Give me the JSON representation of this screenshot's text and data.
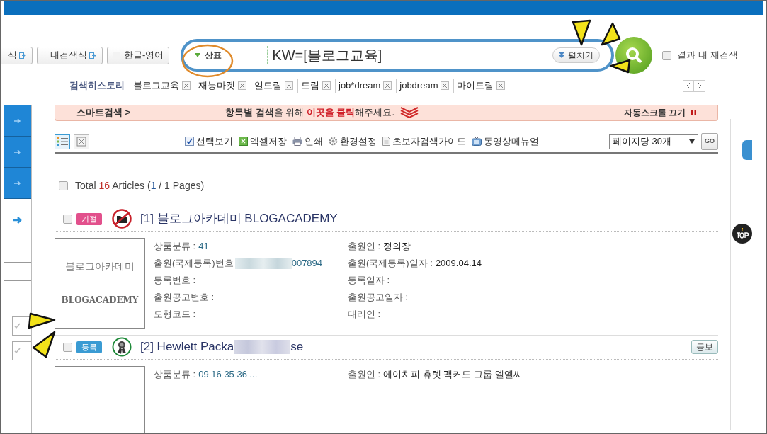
{
  "sidebar": {
    "checkboxes": [
      {
        "checked": true
      },
      {
        "checked": true
      }
    ]
  },
  "search_bar": {
    "formula_buttons": [
      {
        "label": "식"
      },
      {
        "label": "내검색식"
      }
    ],
    "language_toggle": {
      "label": "한글-영어",
      "checked": false
    },
    "category": "상표",
    "query": "KW=[블로그교육]",
    "expand_button": "펼치기",
    "refine": {
      "label": "결과 내 재검색",
      "checked": false
    }
  },
  "history": {
    "label": "검색히스토리",
    "items": [
      {
        "label": "블로그교육"
      },
      {
        "label": "재능마켓"
      },
      {
        "label": "일드림"
      },
      {
        "label": "드림"
      },
      {
        "label": "job*dream"
      },
      {
        "label": "jobdream"
      },
      {
        "label": "마이드림"
      }
    ]
  },
  "smart_banner": {
    "title": "스마트검색 >",
    "message": [
      {
        "text": "항목별 검색",
        "kind": "bold"
      },
      {
        "text": "을 위해 ",
        "kind": "plain"
      },
      {
        "text": "이곳을 클릭",
        "kind": "highlight"
      },
      {
        "text": "해주세요.",
        "kind": "plain"
      }
    ],
    "auto_scroll": "자동스크롤 끄기"
  },
  "toolbar": {
    "view_modes": [
      {
        "kind": "list",
        "selected": true
      },
      {
        "kind": "grid",
        "selected": false
      }
    ],
    "actions": [
      {
        "label": "선택보기",
        "kind": "check"
      },
      {
        "label": "엑셀저장",
        "kind": "excel"
      },
      {
        "label": "인쇄",
        "kind": "print"
      },
      {
        "label": "환경설정",
        "kind": "gear"
      },
      {
        "label": "초보자검색가이드",
        "kind": "doc"
      },
      {
        "label": "동영상메뉴얼",
        "kind": "tv"
      }
    ],
    "per_page": "페이지당 30개",
    "go": "GO"
  },
  "summary": {
    "checked": false,
    "parts": [
      {
        "text": "Total ",
        "kind": "plain"
      },
      {
        "text": "16",
        "kind": "count"
      },
      {
        "text": " Articles (",
        "kind": "plain"
      },
      {
        "text": "1",
        "kind": "page"
      },
      {
        "text": " / 1 Pages)",
        "kind": "plain"
      }
    ]
  },
  "results": [
    {
      "checked": false,
      "status": "거절",
      "kind": "rejected",
      "title": "[1] 블로그아카데미 BLOGACADEMY",
      "mark_image": [
        "블로그아카데미",
        "BLOGACADEMY"
      ],
      "left_fields": [
        {
          "label": "상품분류 :",
          "value": "41",
          "link": true
        },
        {
          "label": "출원(국제등록)번호",
          "value": "007894",
          "link": true,
          "redacted": true
        },
        {
          "label": "등록번호 :"
        },
        {
          "label": "출원공고번호 :"
        },
        {
          "label": "도형코드 :"
        }
      ],
      "right_fields": [
        {
          "label": "출원인 :",
          "value": "정의장"
        },
        {
          "label": "출원(국제등록)일자 :",
          "value": "2009.04.14"
        },
        {
          "label": "등록일자 :"
        },
        {
          "label": "출원공고일자 :"
        },
        {
          "label": "대리인 :"
        }
      ]
    },
    {
      "checked": false,
      "status": "등록",
      "kind": "registered",
      "title": "[2] Hewlett Packa",
      "title_tail": "se",
      "title_redacted": true,
      "gazette_button": "공보",
      "left_fields": [
        {
          "label": "상품분류 :",
          "value": "09 16 35 36 ...",
          "link": true
        }
      ],
      "right_fields": [
        {
          "label": "출원인 :",
          "value": "에이치피 휴렛 팩커드 그룹 엘엘씨"
        }
      ]
    }
  ]
}
